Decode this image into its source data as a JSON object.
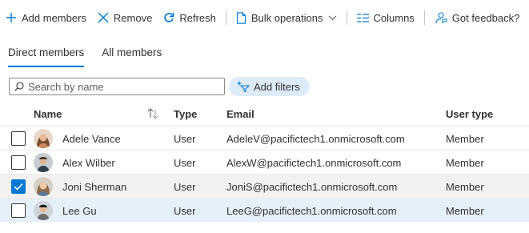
{
  "toolbar": {
    "add_members": "Add members",
    "remove": "Remove",
    "refresh": "Refresh",
    "bulk_operations": "Bulk operations",
    "columns": "Columns",
    "feedback": "Got feedback?"
  },
  "tabs": [
    {
      "label": "Direct members",
      "active": true
    },
    {
      "label": "All members",
      "active": false
    }
  ],
  "search": {
    "placeholder": "Search by name"
  },
  "filters": {
    "label": "Add filters"
  },
  "table": {
    "headers": {
      "name": "Name",
      "type": "Type",
      "email": "Email",
      "user_type": "User type"
    },
    "rows": [
      {
        "name": "Adele Vance",
        "type": "User",
        "email": "AdeleV@pacifictech1.onmicrosoft.com",
        "user_type": "Member",
        "checked": false
      },
      {
        "name": "Alex Wilber",
        "type": "User",
        "email": "AlexW@pacifictech1.onmicrosoft.com",
        "user_type": "Member",
        "checked": false
      },
      {
        "name": "Joni Sherman",
        "type": "User",
        "email": "JoniS@pacifictech1.onmicrosoft.com",
        "user_type": "Member",
        "checked": true
      },
      {
        "name": "Lee Gu",
        "type": "User",
        "email": "LeeG@pacifictech1.onmicrosoft.com",
        "user_type": "Member",
        "checked": false
      }
    ]
  },
  "colors": {
    "accent": "#0078d4",
    "filter_bg": "#deecf9",
    "selected_row": "#f3f2f1",
    "hover_row": "#e6f0fa"
  },
  "icons": [
    "plus-icon",
    "close-icon",
    "refresh-icon",
    "document-icon",
    "chevron-down-icon",
    "columns-icon",
    "feedback-icon",
    "search-icon",
    "add-filter-icon",
    "sort-icon",
    "checkmark-icon"
  ]
}
